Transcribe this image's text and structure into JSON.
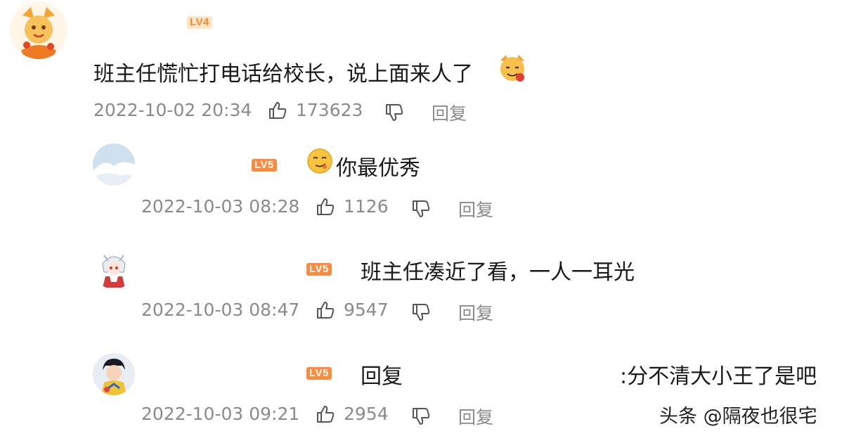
{
  "comments": [
    {
      "level_badge": "LV4",
      "text": "班主任慌忙打电话给校长，说上面来人了",
      "time": "2022-10-02 20:34",
      "likes": "173623",
      "reply_label": "回复"
    },
    {
      "level_badge": "LV5",
      "text": "你最优秀",
      "time": "2022-10-03 08:28",
      "likes": "1126",
      "reply_label": "回复"
    },
    {
      "level_badge": "LV5",
      "text": "班主任凑近了看，一人一耳光",
      "time": "2022-10-03 08:47",
      "likes": "9547",
      "reply_label": "回复"
    },
    {
      "level_badge": "LV5",
      "text_prefix": "回复",
      "text": ":分不清大小王了是吧",
      "time": "2022-10-03 09:21",
      "likes": "2954",
      "reply_label": "回复"
    }
  ],
  "watermark": "头条 @隔夜也很宅",
  "colors": {
    "text": "#1a1a1a",
    "meta": "#8a8a8a",
    "badge_lv5": "#ff8a3d",
    "badge_lv4_bg": "#ffe4c7"
  }
}
